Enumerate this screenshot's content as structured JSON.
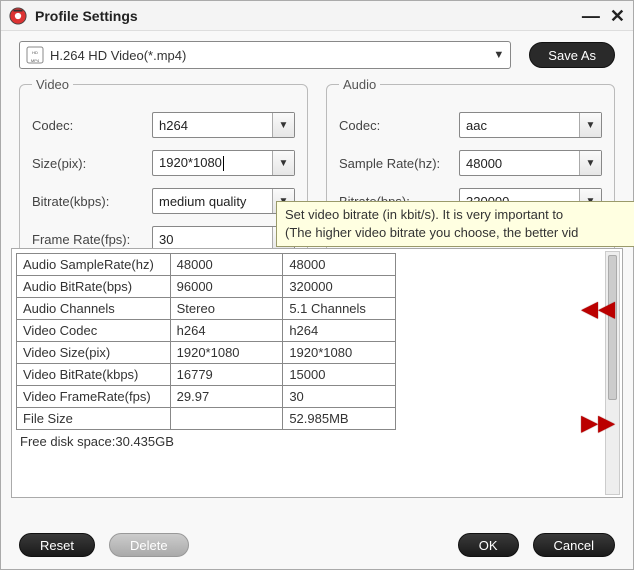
{
  "window": {
    "title": "Profile Settings"
  },
  "profile": {
    "selected": "H.264 HD Video(*.mp4)"
  },
  "saveas_label": "Save As",
  "video_panel": {
    "legend": "Video",
    "codec_label": "Codec:",
    "codec_value": "h264",
    "size_label": "Size(pix):",
    "size_value": "1920*1080",
    "bitrate_label": "Bitrate(kbps):",
    "bitrate_value": "medium quality",
    "framerate_label": "Frame Rate(fps):",
    "framerate_value": "30"
  },
  "audio_panel": {
    "legend": "Audio",
    "codec_label": "Codec:",
    "codec_value": "aac",
    "samplerate_label": "Sample Rate(hz):",
    "samplerate_value": "48000",
    "bitrate_label": "Bitrate(bps):",
    "bitrate_value": "320000"
  },
  "tooltip": {
    "line1": "Set video bitrate (in kbit/s). It is very important to",
    "line2": "(The higher video bitrate you choose, the better vid"
  },
  "table": {
    "rows": [
      [
        "Audio SampleRate(hz)",
        "48000",
        "48000"
      ],
      [
        "Audio BitRate(bps)",
        "96000",
        "320000"
      ],
      [
        "Audio Channels",
        "Stereo",
        "5.1 Channels"
      ],
      [
        "Video Codec",
        "h264",
        "h264"
      ],
      [
        "Video Size(pix)",
        "1920*1080",
        "1920*1080"
      ],
      [
        "Video BitRate(kbps)",
        "16779",
        "15000"
      ],
      [
        "Video FrameRate(fps)",
        "29.97",
        "30"
      ],
      [
        "File Size",
        "",
        "52.985MB"
      ]
    ]
  },
  "free_space": "Free disk space:30.435GB",
  "buttons": {
    "reset": "Reset",
    "delete": "Delete",
    "ok": "OK",
    "cancel": "Cancel"
  }
}
